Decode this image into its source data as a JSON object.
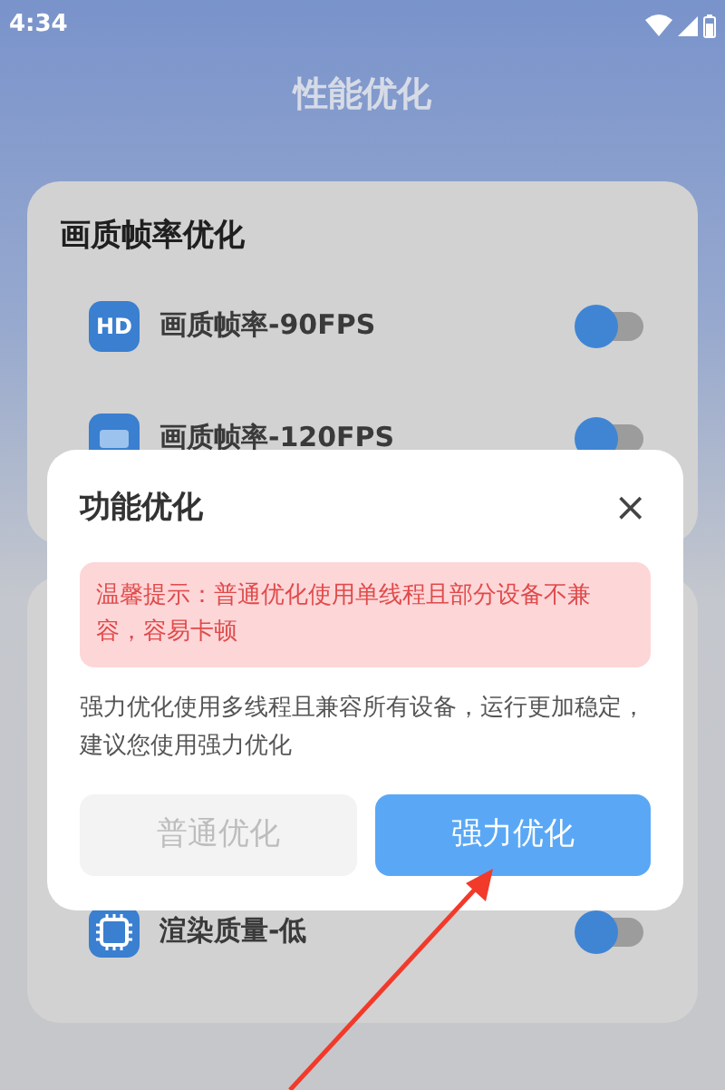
{
  "status_bar": {
    "time": "4:34"
  },
  "header": {
    "title": "性能优化"
  },
  "cards": [
    {
      "title": "画质帧率优化",
      "rows": [
        {
          "kind": "hd",
          "badge": "HD",
          "label": "画质帧率-90FPS",
          "on": false
        },
        {
          "kind": "hd",
          "label": "画质帧率-120FPS",
          "on": false
        }
      ]
    },
    {
      "rows": [
        {
          "kind": "chip",
          "label": "渲染质量-低",
          "on": false
        }
      ]
    }
  ],
  "dialog": {
    "title": "功能优化",
    "close": "×",
    "warning": "温馨提示：普通优化使用单线程且部分设备不兼容，容易卡顿",
    "message": "强力优化使用多线程且兼容所有设备，运行更加稳定，建议您使用强力优化",
    "buttons": [
      {
        "label": "普通优化",
        "selected": false
      },
      {
        "label": "强力优化",
        "selected": true
      }
    ]
  }
}
